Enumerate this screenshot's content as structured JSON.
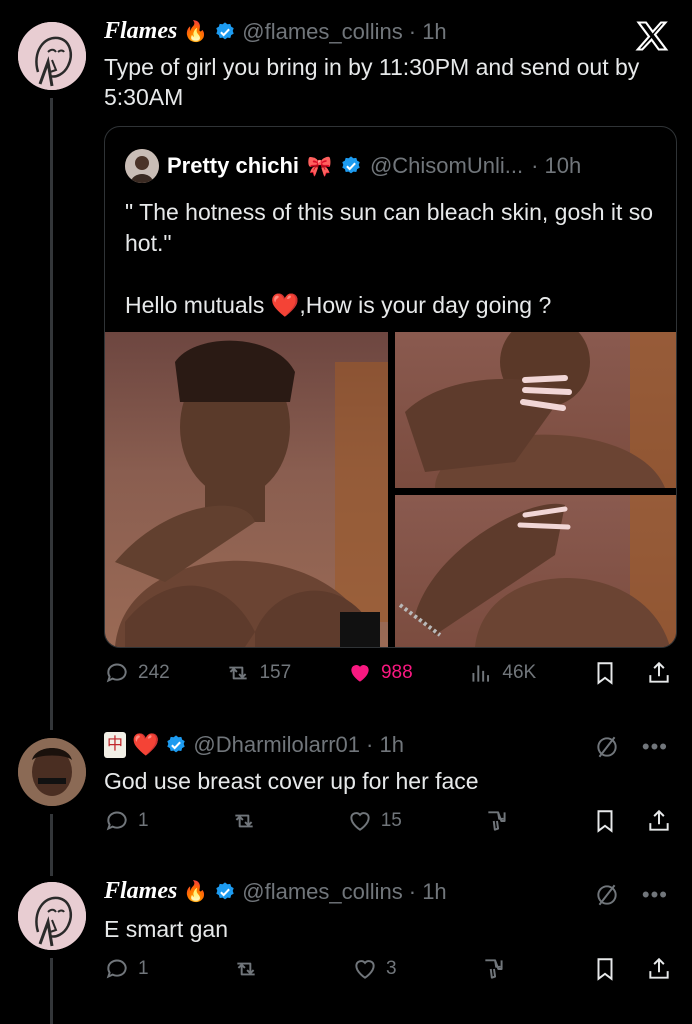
{
  "main_tweet": {
    "display_name": "Flames",
    "handle": "@flames_collins",
    "time": "· 1h",
    "text": "Type of girl you bring in by 11:30PM and send out by 5:30AM"
  },
  "quote": {
    "display_name": "Pretty chichi",
    "handle": "@ChisomUnli...",
    "time": "· 10h",
    "text": "\" The hotness of this sun can bleach skin, gosh it so hot.\"\n\nHello mutuals ",
    "text_tail": ",How is your day going ?"
  },
  "main_actions": {
    "replies": "242",
    "reposts": "157",
    "likes": "988",
    "views": "46K"
  },
  "reply1": {
    "handle": "@Dharmilolarr01",
    "time": "· 1h",
    "text": "God use breast cover up for her face",
    "replies": "1",
    "reposts": "",
    "likes": "15"
  },
  "reply2": {
    "display_name": "Flames",
    "handle": "@flames_collins",
    "time": "· 1h",
    "text": "E smart gan",
    "replies": "1",
    "reposts": "",
    "likes": "3"
  },
  "icons": {
    "verified": "verified-badge-icon",
    "x_logo": "x-logo-icon",
    "reply": "speech-bubble-icon",
    "repost": "repost-arrows-icon",
    "like": "heart-icon",
    "views": "bar-chart-icon",
    "bookmark": "bookmark-icon",
    "share": "share-icon",
    "grok": "slashed-circle-icon",
    "more": "ellipsis-icon",
    "dislike": "thumbs-down-icon",
    "emoji_fire": "fire-icon",
    "emoji_bow": "bow-icon",
    "emoji_mahjong": "mahjong-tile-icon",
    "emoji_heart": "red-heart-icon"
  },
  "colors": {
    "background": "#000000",
    "text": "#e7e9ea",
    "muted": "#71767b",
    "verified": "#1d9bf0",
    "like": "#f91880"
  }
}
